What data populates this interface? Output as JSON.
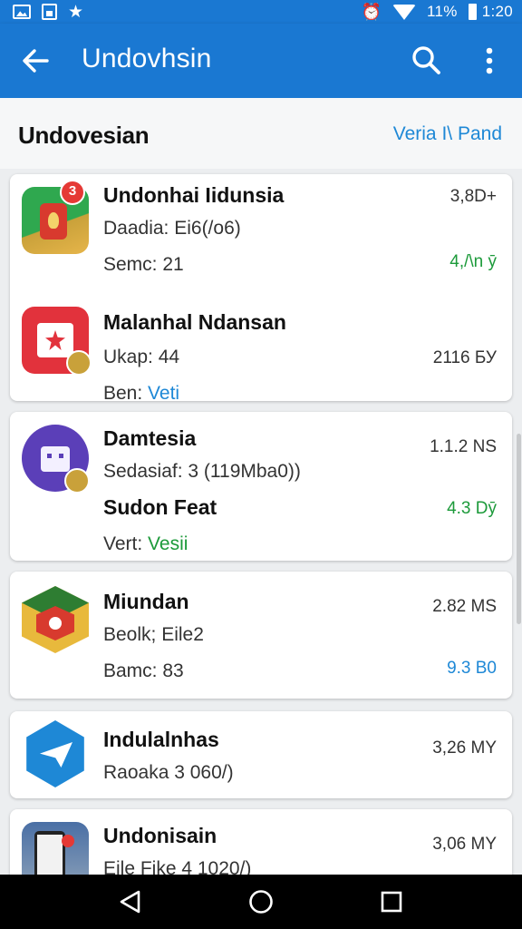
{
  "status_bar": {
    "battery_text": "11%",
    "time": "1:20",
    "icons": [
      "image-icon",
      "document-icon",
      "star-icon",
      "alarm-icon",
      "wifi-icon",
      "battery-icon"
    ]
  },
  "app_bar": {
    "title": "Undovhsin",
    "back_icon": "arrow-back-icon",
    "search_icon": "search-icon",
    "more_icon": "more-vert-icon",
    "color": "#1a78d2"
  },
  "section": {
    "title": "Undovesian",
    "link": "Veria I\\ Pand"
  },
  "apps": [
    {
      "name": "Undonhai Iidunsia",
      "line1": "Daadia: Ei6(/o6)",
      "line2": "Semc: 21",
      "size": "3,8D+",
      "size2": "4,/\\n ӯ"
    },
    {
      "name": "Malanhal Ndansan",
      "line1": "Ukap: 44",
      "line2_label": "Ben:",
      "line2_value": "Veti",
      "size": "2116 БУ"
    },
    {
      "name": "Damtesia",
      "line1": "Sedasiaf: 3 (119Mba0))",
      "line2": "Sudon Feat",
      "line3_label": "Vert:",
      "line3_value": "Vesii",
      "size": "1.1.2 NS",
      "size2": "4.3 Dӯ"
    },
    {
      "name": "Miundan",
      "line1": "Beolk; Eile2",
      "line2": "Bamc: 83",
      "size": "2.82 MS",
      "size2": "9.3 B0"
    },
    {
      "name": "Indulalnhas",
      "line1": "Raoaka 3 060/)",
      "size": "3,26 MY"
    },
    {
      "name": "Undonisain",
      "line1": "Eile Fike 4 1020/)",
      "size": "3,06 MY"
    }
  ],
  "nav_bar": {
    "icons": [
      "back-triangle-icon",
      "home-circle-icon",
      "recents-square-icon"
    ]
  }
}
